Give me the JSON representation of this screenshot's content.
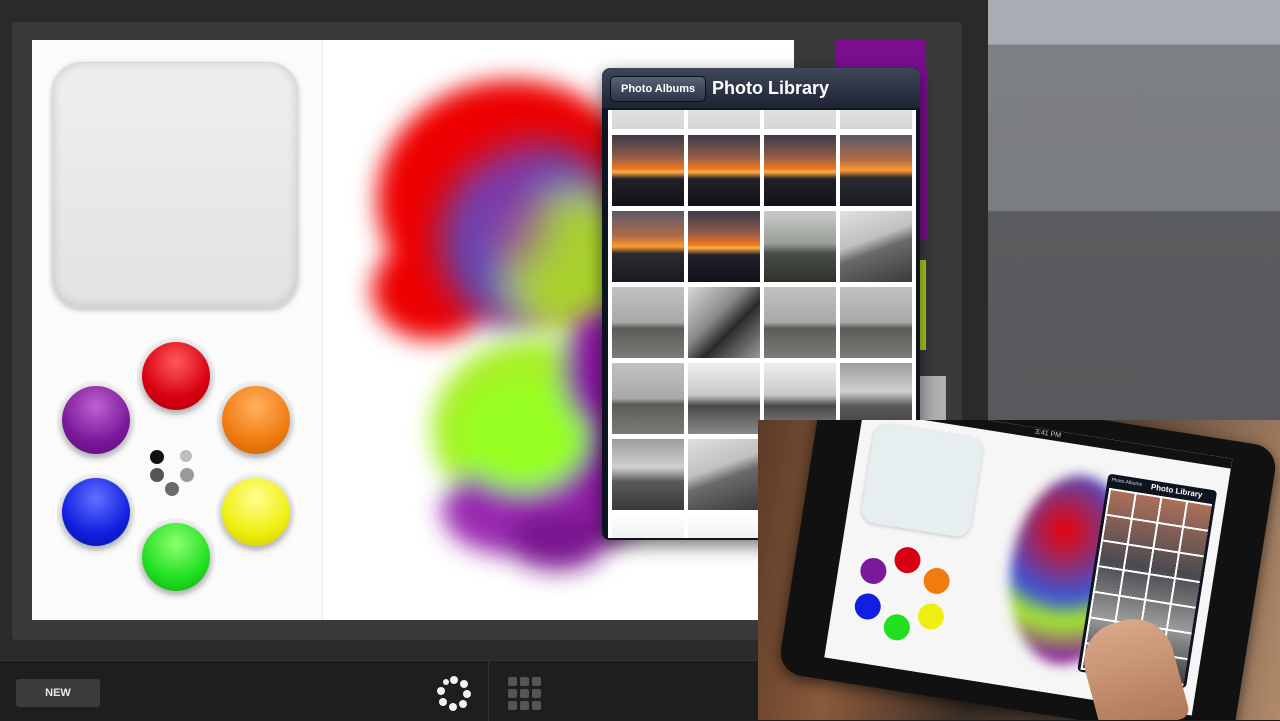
{
  "toolbar": {
    "new_label": "NEW"
  },
  "photo_picker": {
    "albums_button": "Photo Albums",
    "title": "Photo Library"
  },
  "inset": {
    "status_text": "3:41 PM",
    "albums_button": "Photo Albums",
    "title": "Photo Library"
  },
  "palette": {
    "swatches": [
      "red",
      "orange",
      "yellow",
      "green",
      "blue",
      "purple"
    ],
    "colors": {
      "red": "#d80010",
      "orange": "#f07c10",
      "yellow": "#f0ee10",
      "green": "#20e020",
      "blue": "#1020e0",
      "purple": "#7a1a9a"
    }
  },
  "icons": {
    "brush": "brush-size-icon",
    "spinner": "spinner-icon",
    "grid": "grid-icon"
  }
}
